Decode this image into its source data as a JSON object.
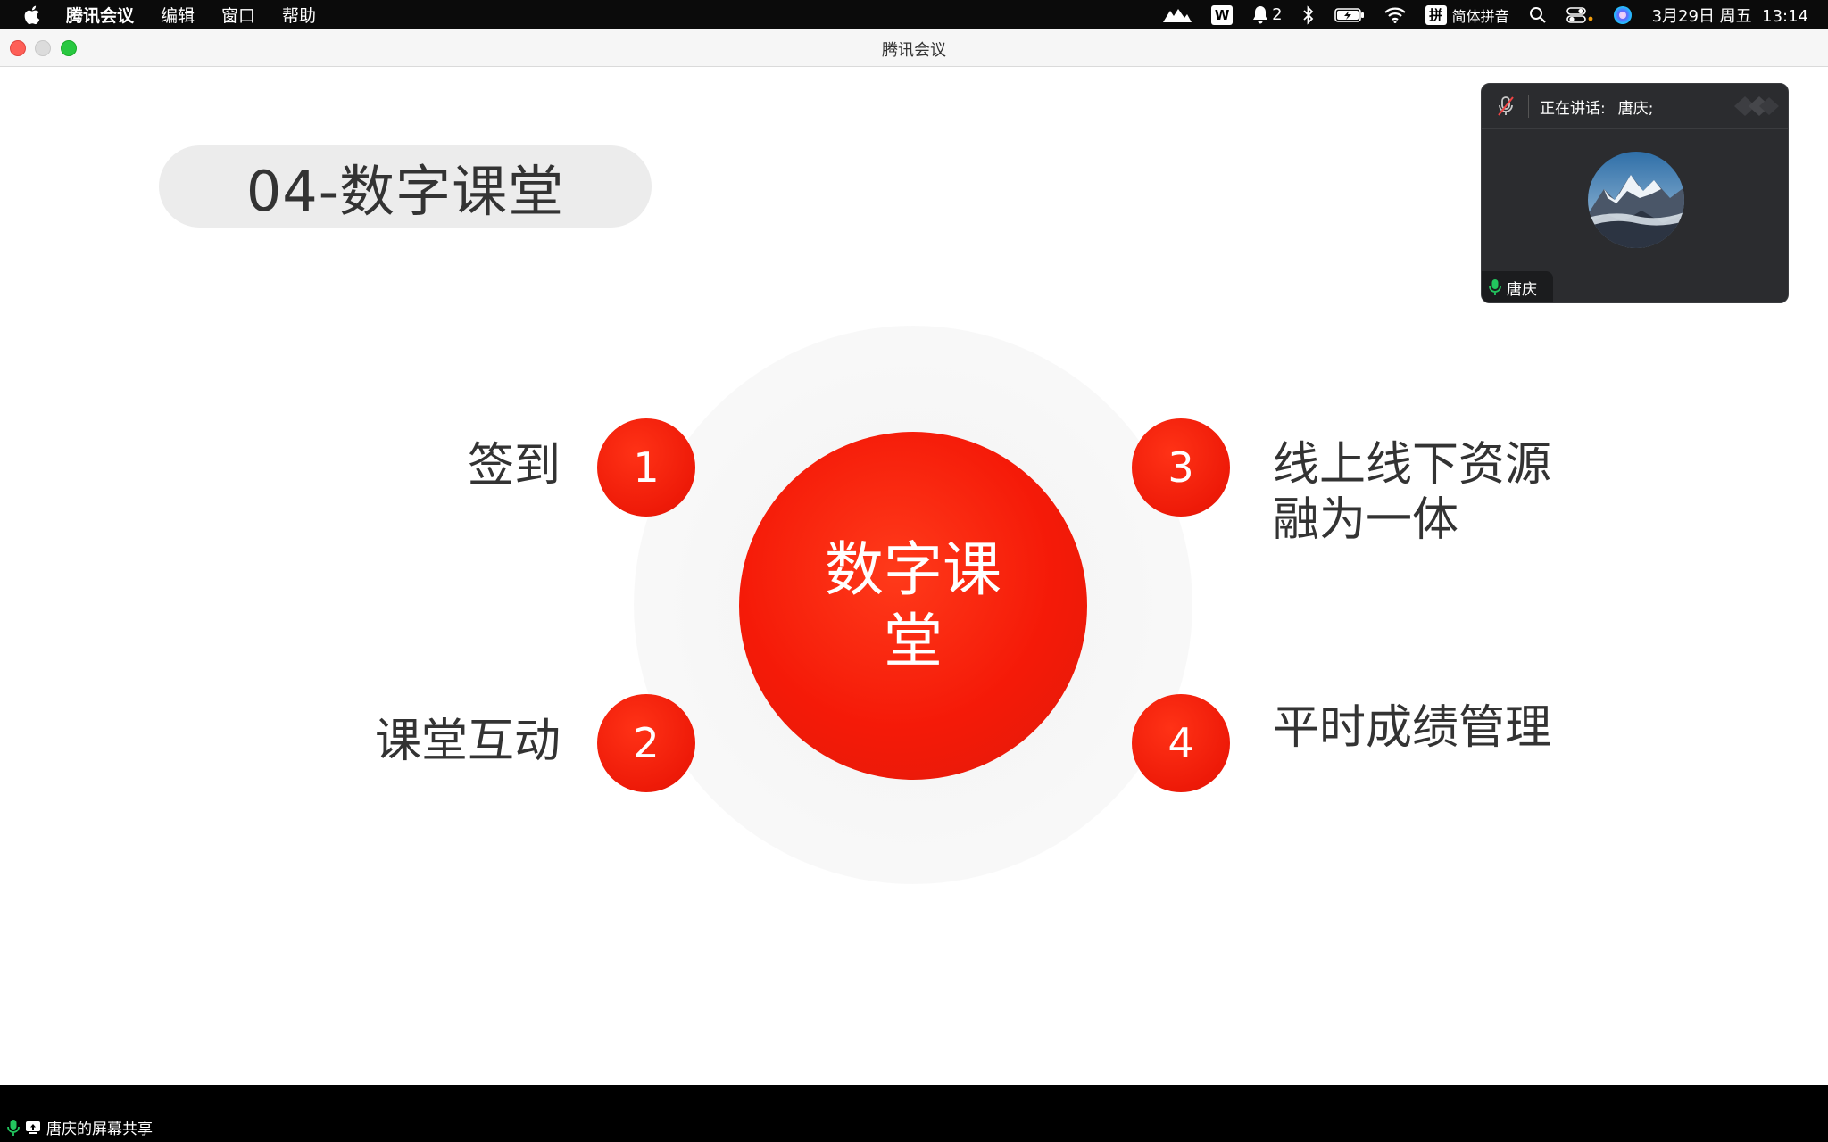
{
  "menubar": {
    "apple_icon": "apple-logo-icon",
    "app_name": "腾讯会议",
    "menus": [
      "编辑",
      "窗口",
      "帮助"
    ],
    "notifications_count": "2",
    "input_method_label": "简体拼音",
    "datetime": "3月29日 周五  13:14"
  },
  "window": {
    "title": "腾讯会议"
  },
  "slide": {
    "title": "04-数字课堂",
    "center_text": "数字课堂",
    "items": [
      {
        "number": "1",
        "label": "签到"
      },
      {
        "number": "2",
        "label": "课堂互动"
      },
      {
        "number": "3",
        "label": "线上线下资源融为一体"
      },
      {
        "number": "4",
        "label": "平时成绩管理"
      }
    ],
    "accent_color": "#f51a08"
  },
  "speaker_panel": {
    "speaking_label": "正在讲话:",
    "speaking_name": "唐庆;",
    "participant_name": "唐庆",
    "mic_on_color": "#22c55e"
  },
  "status": {
    "share_text": "唐庆的屏幕共享"
  }
}
